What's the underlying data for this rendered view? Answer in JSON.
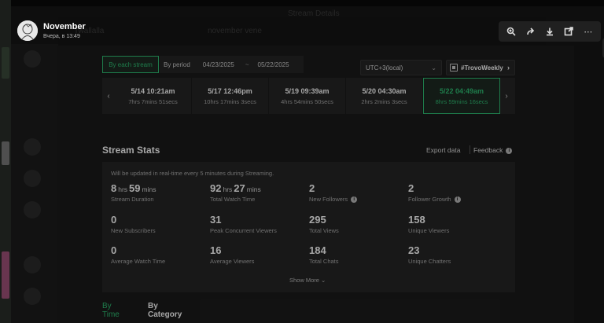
{
  "background": {
    "faint_breadcrumb": "Twallalla",
    "faint_search": "november vene",
    "faint_title": "Stream Details"
  },
  "viewer": {
    "user_name": "November",
    "timestamp": "Вчера, в 13:49"
  },
  "filters": {
    "by_each_stream": "By each stream",
    "by_period": "By period",
    "start_date": "04/23/2025",
    "dash": "~",
    "end_date": "05/22/2025",
    "timezone": "UTC+3(local)",
    "weekly_tag": "#TrovoWeekly"
  },
  "streams": [
    {
      "start": "5/14 10:21am",
      "duration": "7hrs 7mins 51secs"
    },
    {
      "start": "5/17 12:46pm",
      "duration": "10hrs 17mins 3secs"
    },
    {
      "start": "5/19 09:39am",
      "duration": "4hrs 54mins 50secs"
    },
    {
      "start": "5/20 04:30am",
      "duration": "2hrs 2mins 3secs"
    },
    {
      "start": "5/22 04:49am",
      "duration": "8hrs 59mins 16secs"
    }
  ],
  "stats": {
    "title": "Stream Stats",
    "export": "Export data",
    "feedback": "Feedback",
    "notice": "Will be updated in real-time every 5 minutes during Streaming.",
    "show_more": "Show More",
    "items": [
      {
        "v1": "8",
        "u1": "hrs",
        "v2": "59",
        "u2": "mins",
        "label": "Stream Duration"
      },
      {
        "v1": "92",
        "u1": "hrs",
        "v2": "27",
        "u2": "mins",
        "label": "Total Watch Time"
      },
      {
        "v1": "2",
        "label": "New Followers"
      },
      {
        "v1": "2",
        "label": "Follower Growth"
      },
      {
        "v1": "0",
        "label": "New Subscribers"
      },
      {
        "v1": "31",
        "label": "Peak Concurrent Viewers"
      },
      {
        "v1": "295",
        "label": "Total Views"
      },
      {
        "v1": "158",
        "label": "Unique Viewers"
      },
      {
        "v1": "0",
        "label": "Average Watch Time"
      },
      {
        "v1": "16",
        "label": "Average Viewers"
      },
      {
        "v1": "184",
        "label": "Total Chats"
      },
      {
        "v1": "23",
        "label": "Unique Chatters"
      }
    ]
  },
  "tabs": {
    "by_time": "By Time",
    "by_category": "By Category"
  },
  "colors": {
    "accent": "#2fbf74",
    "panel": "#1b1b1b",
    "card": "#262626"
  }
}
